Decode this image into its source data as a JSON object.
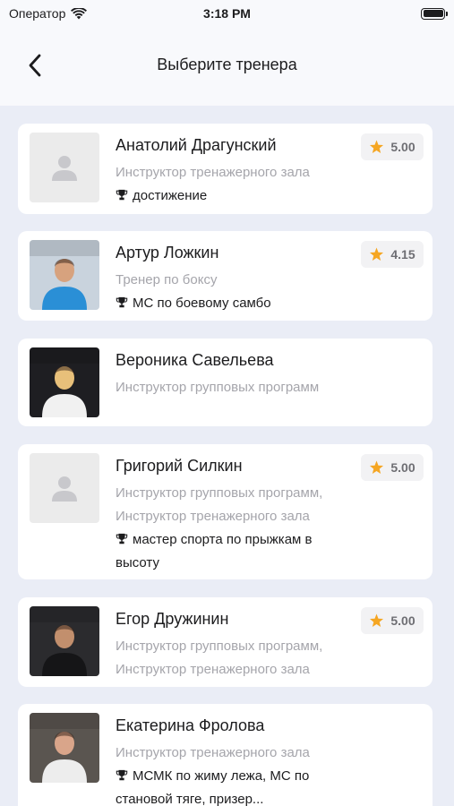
{
  "status_bar": {
    "carrier": "Оператор",
    "time": "3:18 PM"
  },
  "header": {
    "title": "Выберите тренера"
  },
  "colors": {
    "star": "#f5a623",
    "background": "#eaedf6",
    "card": "#ffffff",
    "muted_text": "#a5a5ab"
  },
  "trainers": [
    {
      "name": "Анатолий Драгунский",
      "roles": [
        "Инструктор тренажерного зала"
      ],
      "achievement": "достижение",
      "rating": "5.00",
      "photo": "placeholder"
    },
    {
      "name": "Артур Ложкин",
      "roles": [
        "Тренер по боксу"
      ],
      "achievement": "МС по боевому самбо",
      "rating": "4.15",
      "photo": "photo"
    },
    {
      "name": "Вероника Савельева",
      "roles": [
        "Инструктор групповых программ"
      ],
      "photo": "photo"
    },
    {
      "name": "Григорий Силкин",
      "roles": [
        "Инструктор групповых программ,",
        "Инструктор тренажерного зала"
      ],
      "achievement": "мастер спорта по прыжкам в высоту",
      "rating": "5.00",
      "photo": "placeholder"
    },
    {
      "name": "Егор Дружинин",
      "roles": [
        "Инструктор групповых программ,",
        "Инструктор тренажерного зала"
      ],
      "rating": "5.00",
      "photo": "photo"
    },
    {
      "name": "Екатерина Фролова",
      "roles": [
        "Инструктор тренажерного зала"
      ],
      "achievement": "МСМК по жиму лежа, МС по становой тяге, призер...",
      "photo": "photo"
    }
  ]
}
